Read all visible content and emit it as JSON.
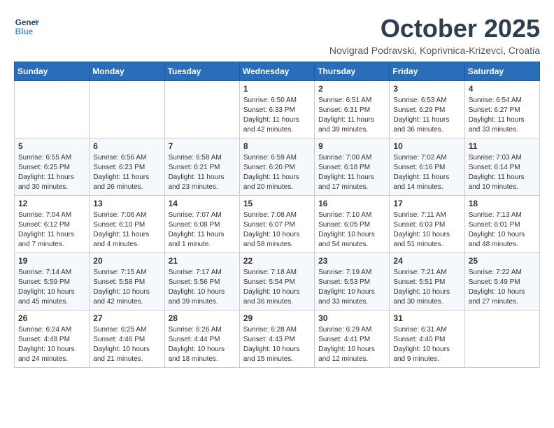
{
  "logo": {
    "line1": "General",
    "line2": "Blue"
  },
  "title": "October 2025",
  "subtitle": "Novigrad Podravski, Koprivnica-Krizevci, Croatia",
  "days_of_week": [
    "Sunday",
    "Monday",
    "Tuesday",
    "Wednesday",
    "Thursday",
    "Friday",
    "Saturday"
  ],
  "weeks": [
    [
      {
        "day": "",
        "info": ""
      },
      {
        "day": "",
        "info": ""
      },
      {
        "day": "",
        "info": ""
      },
      {
        "day": "1",
        "info": "Sunrise: 6:50 AM\nSunset: 6:33 PM\nDaylight: 11 hours and 42 minutes."
      },
      {
        "day": "2",
        "info": "Sunrise: 6:51 AM\nSunset: 6:31 PM\nDaylight: 11 hours and 39 minutes."
      },
      {
        "day": "3",
        "info": "Sunrise: 6:53 AM\nSunset: 6:29 PM\nDaylight: 11 hours and 36 minutes."
      },
      {
        "day": "4",
        "info": "Sunrise: 6:54 AM\nSunset: 6:27 PM\nDaylight: 11 hours and 33 minutes."
      }
    ],
    [
      {
        "day": "5",
        "info": "Sunrise: 6:55 AM\nSunset: 6:25 PM\nDaylight: 11 hours and 30 minutes."
      },
      {
        "day": "6",
        "info": "Sunrise: 6:56 AM\nSunset: 6:23 PM\nDaylight: 11 hours and 26 minutes."
      },
      {
        "day": "7",
        "info": "Sunrise: 6:58 AM\nSunset: 6:21 PM\nDaylight: 11 hours and 23 minutes."
      },
      {
        "day": "8",
        "info": "Sunrise: 6:59 AM\nSunset: 6:20 PM\nDaylight: 11 hours and 20 minutes."
      },
      {
        "day": "9",
        "info": "Sunrise: 7:00 AM\nSunset: 6:18 PM\nDaylight: 11 hours and 17 minutes."
      },
      {
        "day": "10",
        "info": "Sunrise: 7:02 AM\nSunset: 6:16 PM\nDaylight: 11 hours and 14 minutes."
      },
      {
        "day": "11",
        "info": "Sunrise: 7:03 AM\nSunset: 6:14 PM\nDaylight: 11 hours and 10 minutes."
      }
    ],
    [
      {
        "day": "12",
        "info": "Sunrise: 7:04 AM\nSunset: 6:12 PM\nDaylight: 11 hours and 7 minutes."
      },
      {
        "day": "13",
        "info": "Sunrise: 7:06 AM\nSunset: 6:10 PM\nDaylight: 11 hours and 4 minutes."
      },
      {
        "day": "14",
        "info": "Sunrise: 7:07 AM\nSunset: 6:08 PM\nDaylight: 11 hours and 1 minute."
      },
      {
        "day": "15",
        "info": "Sunrise: 7:08 AM\nSunset: 6:07 PM\nDaylight: 10 hours and 58 minutes."
      },
      {
        "day": "16",
        "info": "Sunrise: 7:10 AM\nSunset: 6:05 PM\nDaylight: 10 hours and 54 minutes."
      },
      {
        "day": "17",
        "info": "Sunrise: 7:11 AM\nSunset: 6:03 PM\nDaylight: 10 hours and 51 minutes."
      },
      {
        "day": "18",
        "info": "Sunrise: 7:13 AM\nSunset: 6:01 PM\nDaylight: 10 hours and 48 minutes."
      }
    ],
    [
      {
        "day": "19",
        "info": "Sunrise: 7:14 AM\nSunset: 5:59 PM\nDaylight: 10 hours and 45 minutes."
      },
      {
        "day": "20",
        "info": "Sunrise: 7:15 AM\nSunset: 5:58 PM\nDaylight: 10 hours and 42 minutes."
      },
      {
        "day": "21",
        "info": "Sunrise: 7:17 AM\nSunset: 5:56 PM\nDaylight: 10 hours and 39 minutes."
      },
      {
        "day": "22",
        "info": "Sunrise: 7:18 AM\nSunset: 5:54 PM\nDaylight: 10 hours and 36 minutes."
      },
      {
        "day": "23",
        "info": "Sunrise: 7:19 AM\nSunset: 5:53 PM\nDaylight: 10 hours and 33 minutes."
      },
      {
        "day": "24",
        "info": "Sunrise: 7:21 AM\nSunset: 5:51 PM\nDaylight: 10 hours and 30 minutes."
      },
      {
        "day": "25",
        "info": "Sunrise: 7:22 AM\nSunset: 5:49 PM\nDaylight: 10 hours and 27 minutes."
      }
    ],
    [
      {
        "day": "26",
        "info": "Sunrise: 6:24 AM\nSunset: 4:48 PM\nDaylight: 10 hours and 24 minutes."
      },
      {
        "day": "27",
        "info": "Sunrise: 6:25 AM\nSunset: 4:46 PM\nDaylight: 10 hours and 21 minutes."
      },
      {
        "day": "28",
        "info": "Sunrise: 6:26 AM\nSunset: 4:44 PM\nDaylight: 10 hours and 18 minutes."
      },
      {
        "day": "29",
        "info": "Sunrise: 6:28 AM\nSunset: 4:43 PM\nDaylight: 10 hours and 15 minutes."
      },
      {
        "day": "30",
        "info": "Sunrise: 6:29 AM\nSunset: 4:41 PM\nDaylight: 10 hours and 12 minutes."
      },
      {
        "day": "31",
        "info": "Sunrise: 6:31 AM\nSunset: 4:40 PM\nDaylight: 10 hours and 9 minutes."
      },
      {
        "day": "",
        "info": ""
      }
    ]
  ]
}
